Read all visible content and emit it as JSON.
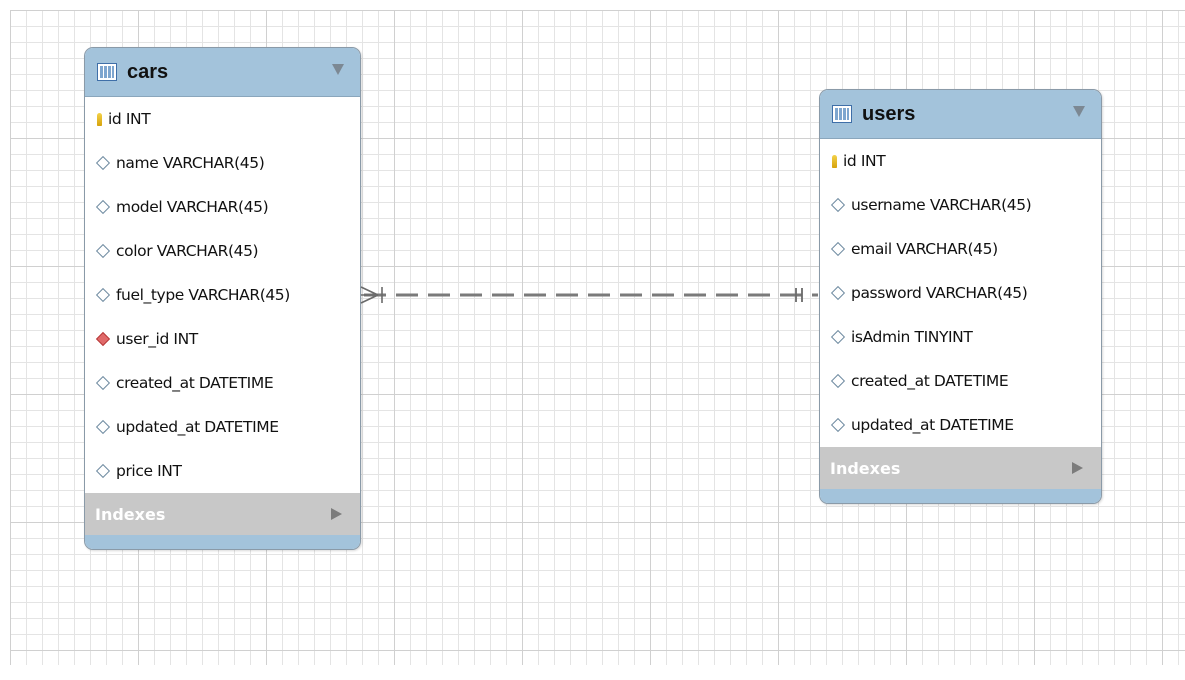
{
  "tables": [
    {
      "name": "cars",
      "columns": [
        {
          "text": "id INT",
          "kind": "primary-key"
        },
        {
          "text": "name VARCHAR(45)",
          "kind": "column"
        },
        {
          "text": "model VARCHAR(45)",
          "kind": "column"
        },
        {
          "text": "color VARCHAR(45)",
          "kind": "column"
        },
        {
          "text": "fuel_type VARCHAR(45)",
          "kind": "column"
        },
        {
          "text": "user_id INT",
          "kind": "foreign-key"
        },
        {
          "text": "created_at DATETIME",
          "kind": "column"
        },
        {
          "text": "updated_at DATETIME",
          "kind": "column"
        },
        {
          "text": "price INT",
          "kind": "column"
        }
      ],
      "indexes_label": "Indexes"
    },
    {
      "name": "users",
      "columns": [
        {
          "text": "id INT",
          "kind": "primary-key"
        },
        {
          "text": "username VARCHAR(45)",
          "kind": "column"
        },
        {
          "text": "email VARCHAR(45)",
          "kind": "column"
        },
        {
          "text": "password VARCHAR(45)",
          "kind": "column"
        },
        {
          "text": "isAdmin TINYINT",
          "kind": "column"
        },
        {
          "text": "created_at DATETIME",
          "kind": "column"
        },
        {
          "text": "updated_at DATETIME",
          "kind": "column"
        }
      ],
      "indexes_label": "Indexes"
    }
  ],
  "relationship": {
    "from": "cars",
    "to": "users",
    "from_cardinality": "one-or-many",
    "to_cardinality": "exactly-one",
    "line_style": "dashed"
  },
  "colors": {
    "header": "#a3c3db",
    "indexes": "#c8c8c8",
    "primary_key": "#e6b81e",
    "foreign_key": "#d9534f",
    "relationship_line": "#7a7a7a"
  }
}
